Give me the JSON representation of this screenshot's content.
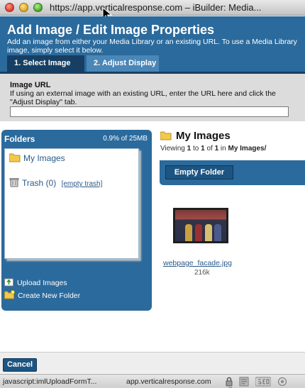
{
  "window": {
    "title": "https://app.verticalresponse.com – iBuilder: Media..."
  },
  "header": {
    "title": "Add Image / Edit Image Properties",
    "subtitle": "Add an image from either your Media Library or an existing URL. To use a Media Library image, simply select it below.",
    "tabs": [
      {
        "label": "1. Select Image",
        "active": true
      },
      {
        "label": "2. Adjust Display",
        "active": false
      }
    ]
  },
  "url_section": {
    "label": "Image URL",
    "help": "If using an external image with an existing URL, enter the URL here and click the \"Adjust Display\" tab.",
    "value": ""
  },
  "folders": {
    "title": "Folders",
    "usage": "0.9% of 25MB",
    "items": [
      {
        "label": "My Images",
        "icon": "folder-icon"
      },
      {
        "label": "Trash (0)",
        "icon": "trash-icon",
        "action": "[empty trash]"
      }
    ],
    "actions": [
      {
        "label": "Upload Images",
        "icon": "upload-icon"
      },
      {
        "label": "Create New Folder",
        "icon": "new-folder-icon"
      }
    ]
  },
  "content": {
    "title": "My Images",
    "viewing": {
      "prefix": "Viewing",
      "start": "1",
      "to": "to",
      "end": "1",
      "of": "of",
      "total": "1",
      "in": "in",
      "folder": "My Images/"
    },
    "empty_folder_label": "Empty Folder",
    "files": [
      {
        "name": "webpage_facade.jpg",
        "size": "216k"
      }
    ]
  },
  "footer": {
    "cancel_label": "Cancel"
  },
  "statusbar": {
    "left": "javascript:imlUploadFormT...",
    "right": "app.verticalresponse.com"
  },
  "colors": {
    "brand_blue": "#2b6a9c",
    "dark_blue": "#163f63",
    "link": "#2b5a8a"
  }
}
